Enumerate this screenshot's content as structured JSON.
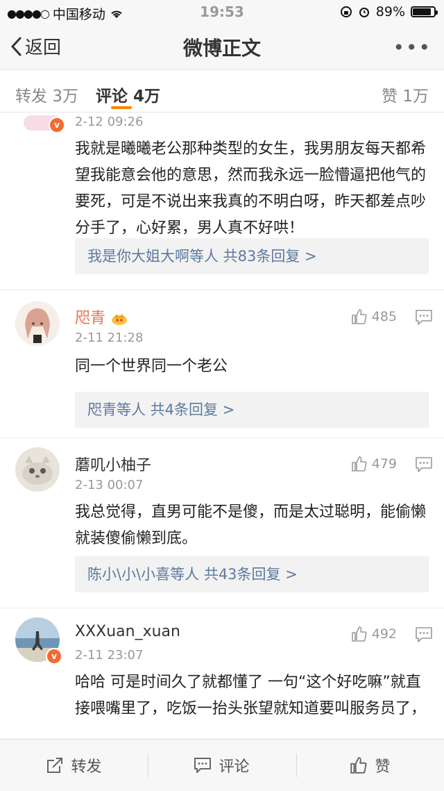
{
  "status_bar": {
    "carrier": "中国移动",
    "time": "19:53",
    "battery": "89%"
  },
  "nav": {
    "back_label": "返回",
    "title": "微博正文"
  },
  "tabs": {
    "repost_label": "转发",
    "repost_count": "3万",
    "comment_label": "评论",
    "comment_count": "4万",
    "like_label": "赞",
    "like_count": "1万"
  },
  "comments": [
    {
      "time": "2-12 09:26",
      "text": "我就是曦曦老公那种类型的女生，我男朋友每天都希望我能意会他的意思，然而我永远一脸懵逼把他气的要死，可是不说出来我真的不明白呀，昨天都差点吵分手了，心好累，男人真不好哄！",
      "replies": "我是你大姐大啊等人  共83条回复 >"
    },
    {
      "name": "咫青",
      "time": "2-11 21:28",
      "likes": "485",
      "text": "同一个世界同一个老公",
      "replies": "咫青等人  共4条回复 >"
    },
    {
      "name": "蘑叽小柚子",
      "time": "2-13 00:07",
      "likes": "479",
      "text": "我总觉得，直男可能不是傻，而是太过聪明，能偷懒就装傻偷懒到底。",
      "replies": "陈小\\小\\小喜等人  共43条回复 >"
    },
    {
      "name": "XXXuan_xuan",
      "time": "2-11 23:07",
      "likes": "492",
      "text": "哈哈 可是时间久了就都懂了 一句“这个好吃嘛”就直接喂嘴里了，吃饭一抬头张望就知道要叫服务员了，"
    }
  ],
  "bottom_bar": {
    "repost": "转发",
    "comment": "评论",
    "like": "赞"
  },
  "colors": {
    "accent": "#ff8200",
    "link": "#5d7a9f",
    "vip_name": "#eb7350"
  }
}
